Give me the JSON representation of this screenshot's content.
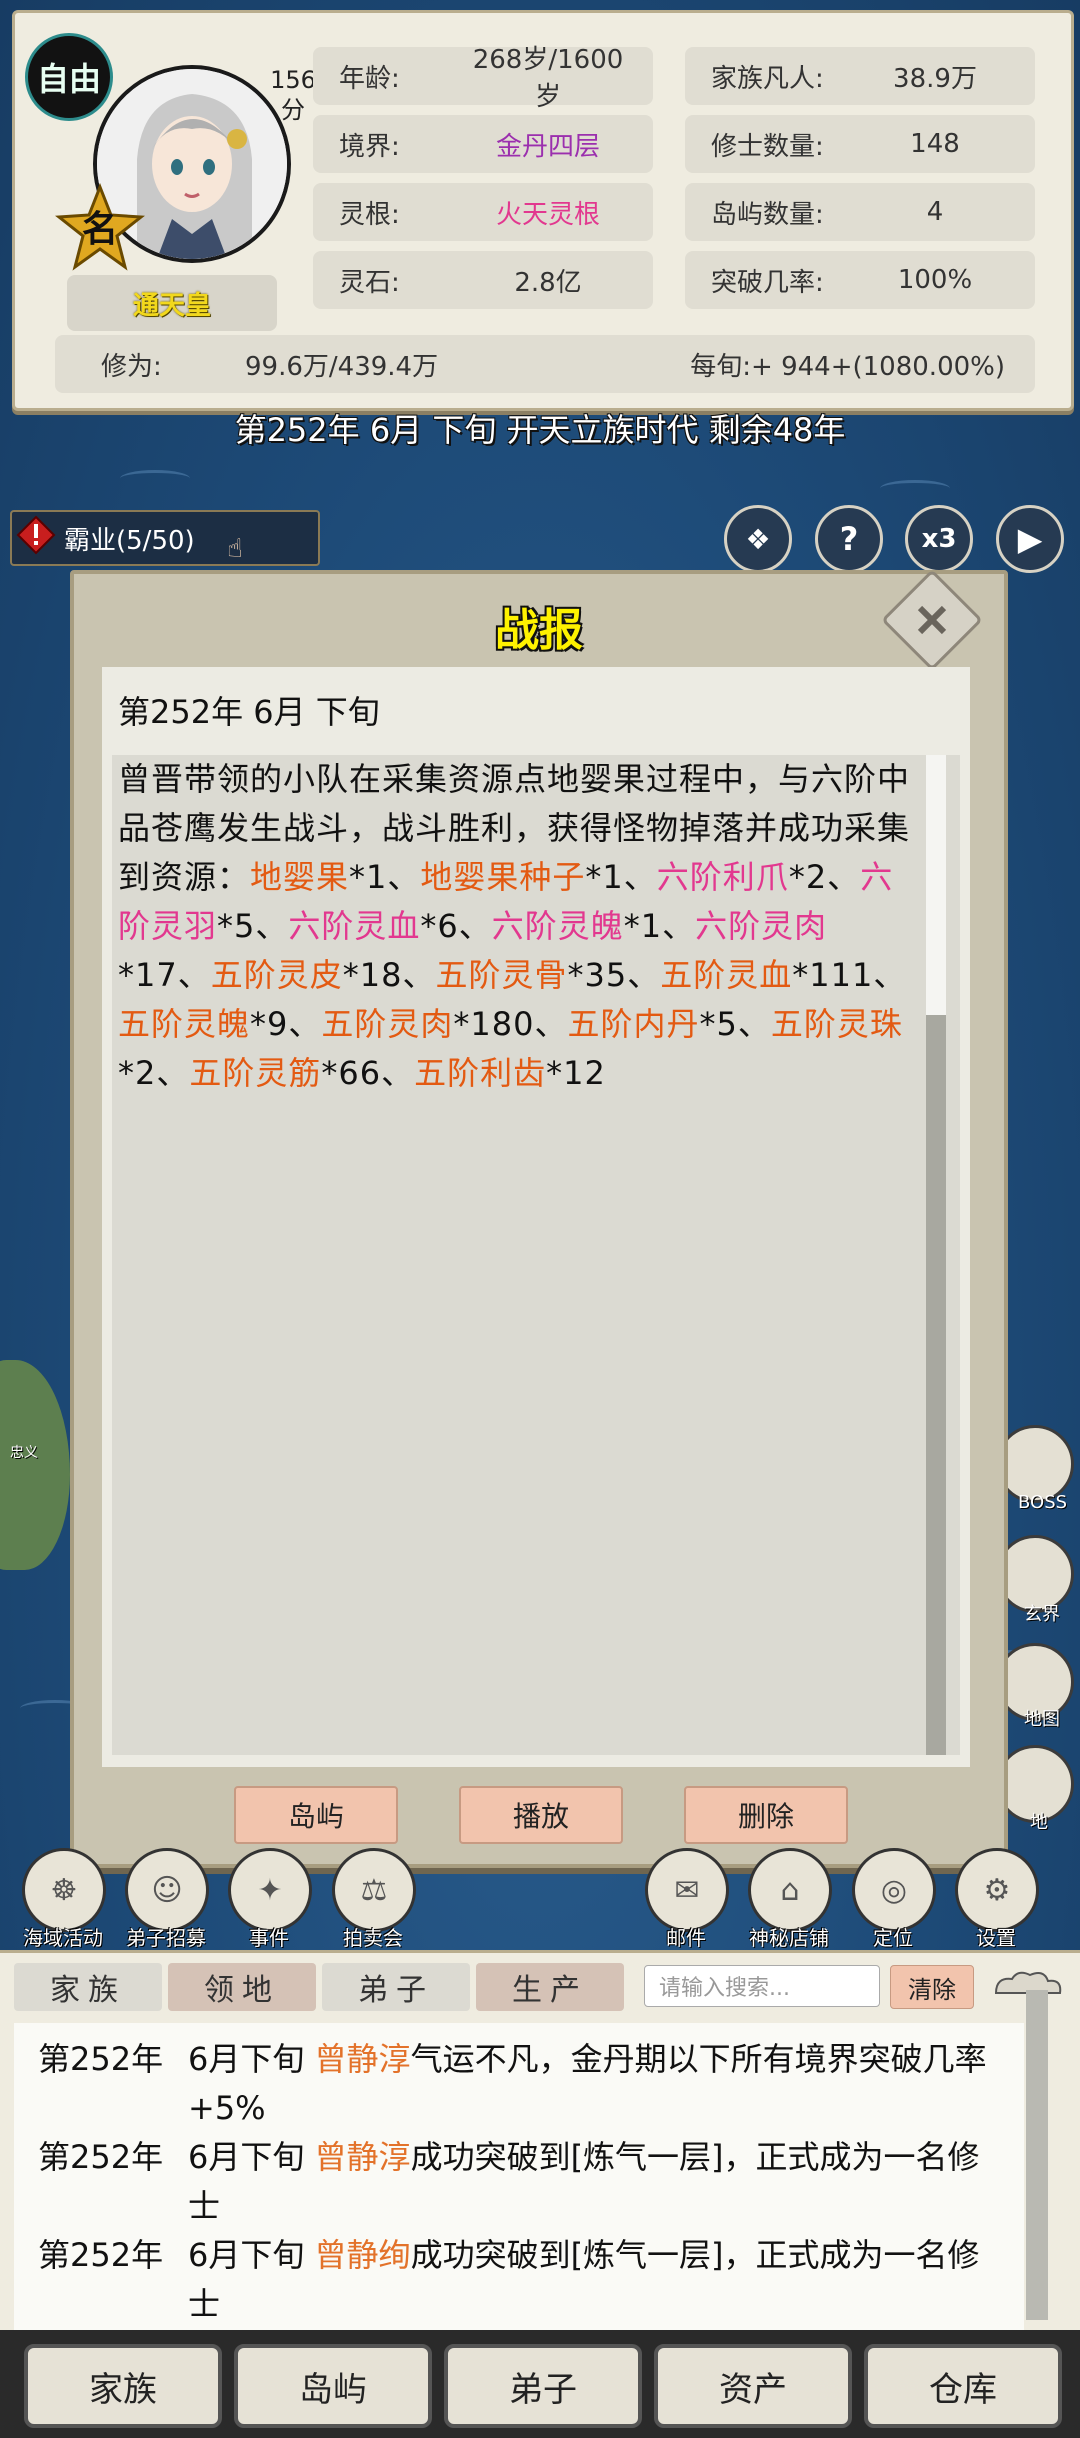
{
  "header": {
    "status_badge": "自由",
    "name_badge": "名",
    "score_value": "156",
    "score_unit": "分",
    "title": "通天皇",
    "stats_left": [
      {
        "label": "年龄:",
        "value": "268岁/1600岁",
        "color": "#333333"
      },
      {
        "label": "境界:",
        "value": "金丹四层",
        "color": "#9b2fae"
      },
      {
        "label": "灵根:",
        "value": "火天灵根",
        "color": "#e2388f"
      },
      {
        "label": "灵石:",
        "value": "2.8亿",
        "color": "#333333"
      }
    ],
    "stats_right": [
      {
        "label": "家族凡人:",
        "value": "38.9万"
      },
      {
        "label": "修士数量:",
        "value": "148"
      },
      {
        "label": "岛屿数量:",
        "value": "4"
      },
      {
        "label": "突破几率:",
        "value": "100%"
      }
    ],
    "cultivation_label": "修为:",
    "cultivation_value": "99.6万/439.4万",
    "per_turn": "每旬:+ 944+(1080.00%)"
  },
  "time_line": "第252年 6月 下旬  开天立族时代 剩余48年",
  "hegemony": {
    "label": "霸业(5/50)"
  },
  "top_buttons": [
    "?",
    "x3"
  ],
  "dialog": {
    "title": "战报",
    "date": "第252年 6月 下旬",
    "report": {
      "intro": "曾晋带领的小队在采集资源点地婴果过程中，与六阶中品苍鹰发生战斗，战斗胜利，获得怪物掉落并成功采集到资源：",
      "items": [
        {
          "name": "地婴果",
          "qty": "*1",
          "color": "o"
        },
        {
          "name": "地婴果种子",
          "qty": "*1",
          "color": "o"
        },
        {
          "name": "六阶利爪",
          "qty": "*2",
          "color": "p"
        },
        {
          "name": "六阶灵羽",
          "qty": "*5",
          "color": "p"
        },
        {
          "name": "六阶灵血",
          "qty": "*6",
          "color": "p"
        },
        {
          "name": "六阶灵魄",
          "qty": "*1",
          "color": "p"
        },
        {
          "name": "六阶灵肉",
          "qty": "*17",
          "color": "p"
        },
        {
          "name": "五阶灵皮",
          "qty": "*18",
          "color": "o"
        },
        {
          "name": "五阶灵骨",
          "qty": "*35",
          "color": "o"
        },
        {
          "name": "五阶灵血",
          "qty": "*111",
          "color": "o"
        },
        {
          "name": "五阶灵魄",
          "qty": "*9",
          "color": "o"
        },
        {
          "name": "五阶灵肉",
          "qty": "*180",
          "color": "o"
        },
        {
          "name": "五阶内丹",
          "qty": "*5",
          "color": "o"
        },
        {
          "name": "五阶灵珠",
          "qty": "*2",
          "color": "o"
        },
        {
          "name": "五阶灵筋",
          "qty": "*66",
          "color": "o"
        },
        {
          "name": "五阶利齿",
          "qty": "*12",
          "color": "o"
        }
      ],
      "separator": "、"
    },
    "buttons": [
      "岛屿",
      "播放",
      "删除"
    ]
  },
  "side_labels": [
    "BOSS",
    "玄界",
    "地图",
    "地"
  ],
  "island_label": "忠义",
  "actions": [
    {
      "label": "海域活动",
      "icon": "sea-activity-icon"
    },
    {
      "label": "弟子招募",
      "icon": "recruit-icon"
    },
    {
      "label": "事件",
      "icon": "event-icon"
    },
    {
      "label": "拍卖会",
      "icon": "auction-icon"
    },
    {
      "label": "邮件",
      "icon": "mail-icon"
    },
    {
      "label": "神秘店铺",
      "icon": "shop-icon"
    },
    {
      "label": "定位",
      "icon": "locate-icon"
    },
    {
      "label": "设置",
      "icon": "settings-icon"
    }
  ],
  "log": {
    "tabs": [
      "家族",
      "领地",
      "弟子",
      "生产"
    ],
    "search_placeholder": "请输入搜索...",
    "clear_label": "清除",
    "entries": [
      {
        "year": "第252年",
        "time": "6月下旬 ",
        "name": "曾静淳",
        "text": "气运不凡，金丹期以下所有境界突破几率+5%"
      },
      {
        "year": "第252年",
        "time": "6月下旬 ",
        "name": "曾静淳",
        "text": "成功突破到[炼气一层]，正式成为一名修士"
      },
      {
        "year": "第252年",
        "time": "6月下旬 ",
        "name": "曾静绚",
        "text": "成功突破到[炼气一层]，正式成为一名修士"
      }
    ]
  },
  "bottom_nav": [
    "家族",
    "岛屿",
    "弟子",
    "资产",
    "仓库"
  ]
}
